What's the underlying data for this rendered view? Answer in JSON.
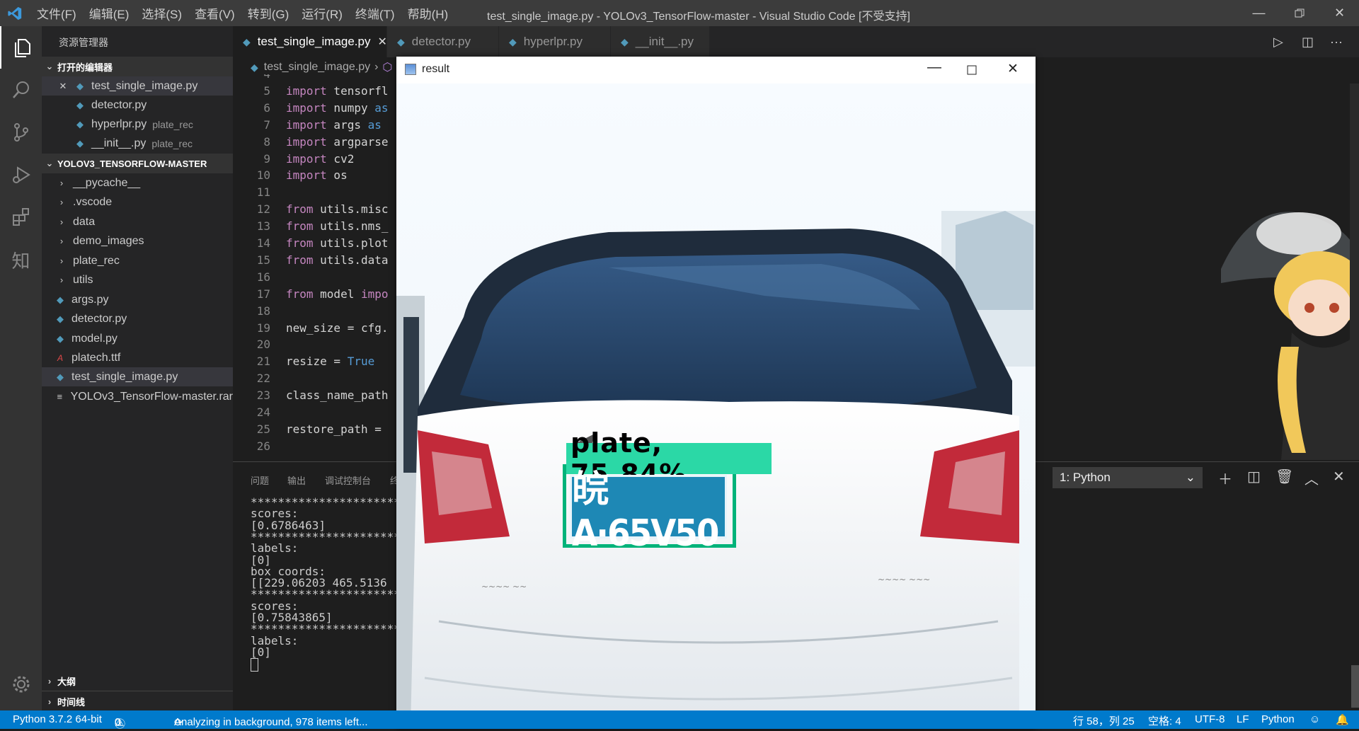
{
  "titlebar": {
    "menu": [
      "文件(F)",
      "编辑(E)",
      "选择(S)",
      "查看(V)",
      "转到(G)",
      "运行(R)",
      "终端(T)",
      "帮助(H)"
    ],
    "window_title": "test_single_image.py - YOLOv3_TensorFlow-master - Visual Studio Code [不受支持]"
  },
  "sidebar": {
    "title": "资源管理器",
    "open_editors_label": "打开的编辑器",
    "open_editors": [
      {
        "name": "test_single_image.py",
        "desc": ""
      },
      {
        "name": "detector.py",
        "desc": ""
      },
      {
        "name": "hyperlpr.py",
        "desc": "plate_rec"
      },
      {
        "name": "__init__.py",
        "desc": "plate_rec"
      }
    ],
    "project_label": "YOLOV3_TENSORFLOW-MASTER",
    "folders": [
      "__pycache__",
      ".vscode",
      "data",
      "demo_images",
      "plate_rec",
      "utils"
    ],
    "files": [
      "args.py",
      "detector.py",
      "model.py",
      "platech.ttf",
      "test_single_image.py",
      "YOLOv3_TensorFlow-master.rar"
    ],
    "outline_label": "大纲",
    "timeline_label": "时间线"
  },
  "tabs": [
    {
      "label": "test_single_image.py",
      "active": true
    },
    {
      "label": "detector.py",
      "active": false
    },
    {
      "label": "hyperlpr.py",
      "active": false
    },
    {
      "label": "__init__.py",
      "active": false
    }
  ],
  "breadcrumb": "test_single_image.py",
  "code_lines": [
    {
      "n": "4",
      "parts": []
    },
    {
      "n": "5",
      "parts": [
        [
          "kw",
          "import"
        ],
        [
          "tx",
          " tensorfl"
        ]
      ]
    },
    {
      "n": "6",
      "parts": [
        [
          "kw",
          "import"
        ],
        [
          "tx",
          " numpy "
        ],
        [
          "kw2",
          "as"
        ]
      ]
    },
    {
      "n": "7",
      "parts": [
        [
          "kw",
          "import"
        ],
        [
          "tx",
          " args "
        ],
        [
          "kw2",
          "as"
        ]
      ]
    },
    {
      "n": "8",
      "parts": [
        [
          "kw",
          "import"
        ],
        [
          "tx",
          " argparse"
        ]
      ]
    },
    {
      "n": "9",
      "parts": [
        [
          "kw",
          "import"
        ],
        [
          "tx",
          " cv2"
        ]
      ]
    },
    {
      "n": "10",
      "parts": [
        [
          "kw",
          "import"
        ],
        [
          "tx",
          " os"
        ]
      ]
    },
    {
      "n": "11",
      "parts": []
    },
    {
      "n": "12",
      "parts": [
        [
          "kw",
          "from"
        ],
        [
          "tx",
          " utils.misc"
        ]
      ]
    },
    {
      "n": "13",
      "parts": [
        [
          "kw",
          "from"
        ],
        [
          "tx",
          " utils.nms_"
        ]
      ]
    },
    {
      "n": "14",
      "parts": [
        [
          "kw",
          "from"
        ],
        [
          "tx",
          " utils.plot"
        ]
      ]
    },
    {
      "n": "15",
      "parts": [
        [
          "kw",
          "from"
        ],
        [
          "tx",
          " utils.data"
        ]
      ]
    },
    {
      "n": "16",
      "parts": []
    },
    {
      "n": "17",
      "parts": [
        [
          "kw",
          "from"
        ],
        [
          "tx",
          " model "
        ],
        [
          "kw",
          "impo"
        ]
      ]
    },
    {
      "n": "18",
      "parts": []
    },
    {
      "n": "19",
      "parts": [
        [
          "tx",
          "new_size = cfg."
        ]
      ]
    },
    {
      "n": "20",
      "parts": []
    },
    {
      "n": "21",
      "parts": [
        [
          "tx",
          "resize = "
        ],
        [
          "kw2",
          "True"
        ]
      ]
    },
    {
      "n": "22",
      "parts": []
    },
    {
      "n": "23",
      "parts": [
        [
          "tx",
          "class_name_path"
        ]
      ]
    },
    {
      "n": "24",
      "parts": []
    },
    {
      "n": "25",
      "parts": [
        [
          "tx",
          "restore_path ="
        ]
      ]
    },
    {
      "n": "26",
      "parts": []
    }
  ],
  "panel_tabs": [
    "问题",
    "输出",
    "调试控制台",
    "终"
  ],
  "terminal_lines": [
    "**********************",
    "scores:",
    "[0.6786463]",
    "**********************",
    "labels:",
    "[0]",
    "box coords:",
    "[[229.06203 465.5136",
    "**********************",
    "scores:",
    "[0.75843865]",
    "**********************",
    "labels:",
    "[0]"
  ],
  "result_window": {
    "title": "result",
    "detection_label": "plate, 75.84%",
    "plate_text": "皖A·65V50"
  },
  "terminal_selector": "1: Python",
  "status": {
    "python": "Python 3.7.2 64-bit",
    "errors": "0",
    "warnings": "0",
    "analyzing": "Analyzing in background, 978 items left...",
    "position": "行 58，列 25",
    "spaces": "空格: 4",
    "encoding": "UTF-8",
    "eol": "LF",
    "language": "Python"
  },
  "colors": {
    "accent": "#007acc",
    "detection_box": "#00b37a",
    "plate_blue": "#1e88b5"
  }
}
